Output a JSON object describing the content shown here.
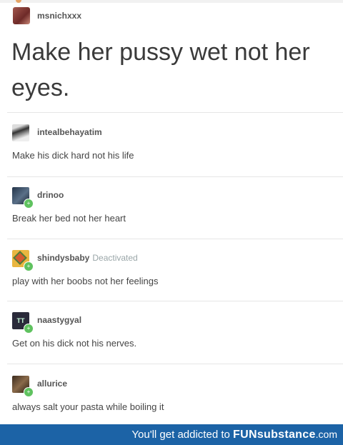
{
  "original_post": {
    "username": "msnichxxx",
    "text": "Make her pussy wet not her eyes."
  },
  "replies": [
    {
      "username": "intealbehayatim",
      "status": "",
      "text": "Make his dick hard not his life"
    },
    {
      "username": "drinoo",
      "status": "",
      "text": "Break her bed not her heart"
    },
    {
      "username": "shindysbaby",
      "status": "Deactivated",
      "text": "play with her boobs not her feelings"
    },
    {
      "username": "naastygyal",
      "status": "",
      "text": "Get on his dick not his nerves."
    },
    {
      "username": "allurice",
      "status": "",
      "text": "always salt your pasta while boiling it"
    }
  ],
  "footer": {
    "prefix": "You'll get addicted to",
    "brand_fun": "FUN",
    "brand_sub": "substance",
    "domain": ".com",
    "background_color": "#1c63a6"
  },
  "icons": {
    "follow_badge": "plus-badge-icon"
  }
}
